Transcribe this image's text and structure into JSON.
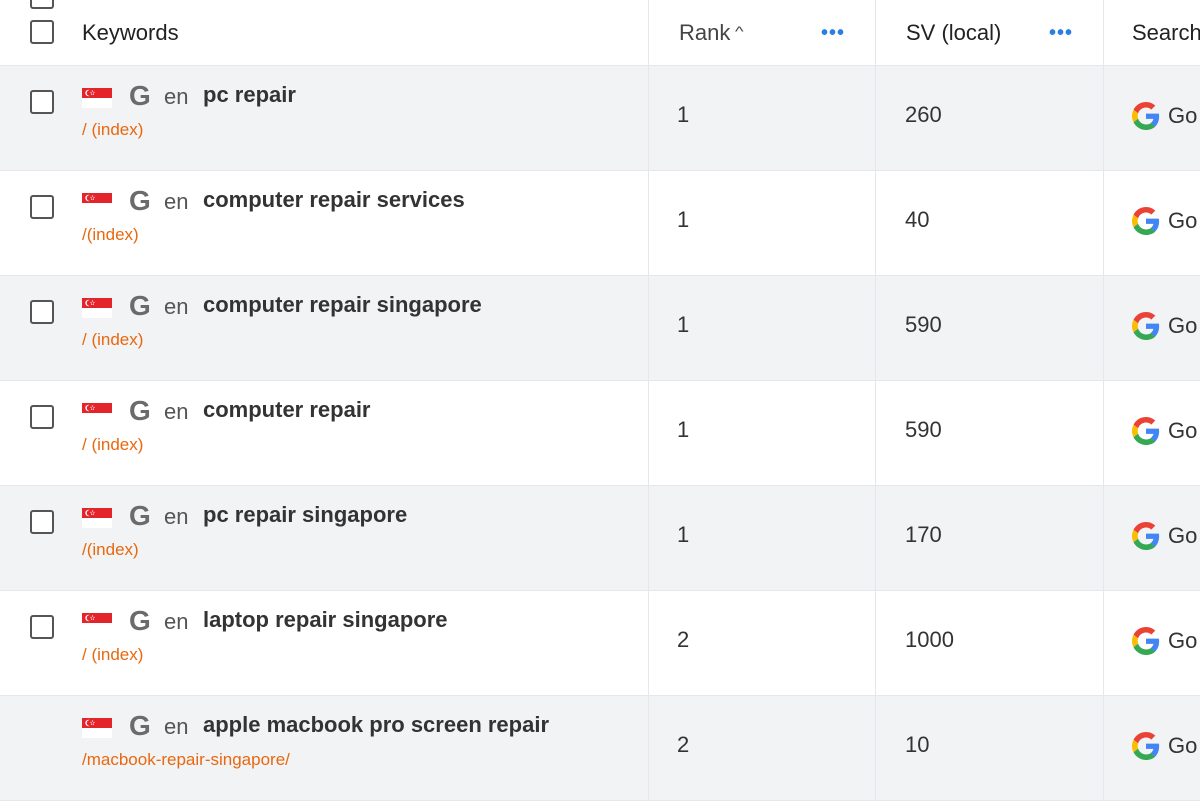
{
  "header": {
    "keywords": "Keywords",
    "rank": "Rank",
    "rank_sort_icon": "chevron-up-icon",
    "sv": "SV (local)",
    "search_engine": "Search",
    "menu_icon": "more-horizontal-icon"
  },
  "rows": [
    {
      "country": "Singapore",
      "engine_icon": "google-g-icon",
      "lang": "en",
      "keyword": "pc repair",
      "url": "/ (index)",
      "rank": "1",
      "sv": "260",
      "engine": "Go"
    },
    {
      "country": "Singapore",
      "engine_icon": "google-g-icon",
      "lang": "en",
      "keyword": "computer repair services",
      "url": "/(index)",
      "rank": "1",
      "sv": "40",
      "engine": "Go"
    },
    {
      "country": "Singapore",
      "engine_icon": "google-g-icon",
      "lang": "en",
      "keyword": "computer repair singapore",
      "url": "/ (index)",
      "rank": "1",
      "sv": "590",
      "engine": "Go"
    },
    {
      "country": "Singapore",
      "engine_icon": "google-g-icon",
      "lang": "en",
      "keyword": "computer repair",
      "url": "/ (index)",
      "rank": "1",
      "sv": "590",
      "engine": "Go"
    },
    {
      "country": "Singapore",
      "engine_icon": "google-g-icon",
      "lang": "en",
      "keyword": "pc repair singapore",
      "url": "/(index)",
      "rank": "1",
      "sv": "170",
      "engine": "Go"
    },
    {
      "country": "Singapore",
      "engine_icon": "google-g-icon",
      "lang": "en",
      "keyword": "laptop repair singapore",
      "url": "/ (index)",
      "rank": "2",
      "sv": "1000",
      "engine": "Go"
    },
    {
      "country": "Singapore",
      "engine_icon": "google-g-icon",
      "lang": "en",
      "keyword": "apple macbook pro screen repair",
      "url": "/macbook-repair-singapore/",
      "rank": "2",
      "sv": "10",
      "engine": "Go"
    }
  ],
  "colors": {
    "url": "#e8680f",
    "accent": "#2a7de1",
    "row_alt": "#f2f3f5",
    "border": "#e6e7ea"
  }
}
